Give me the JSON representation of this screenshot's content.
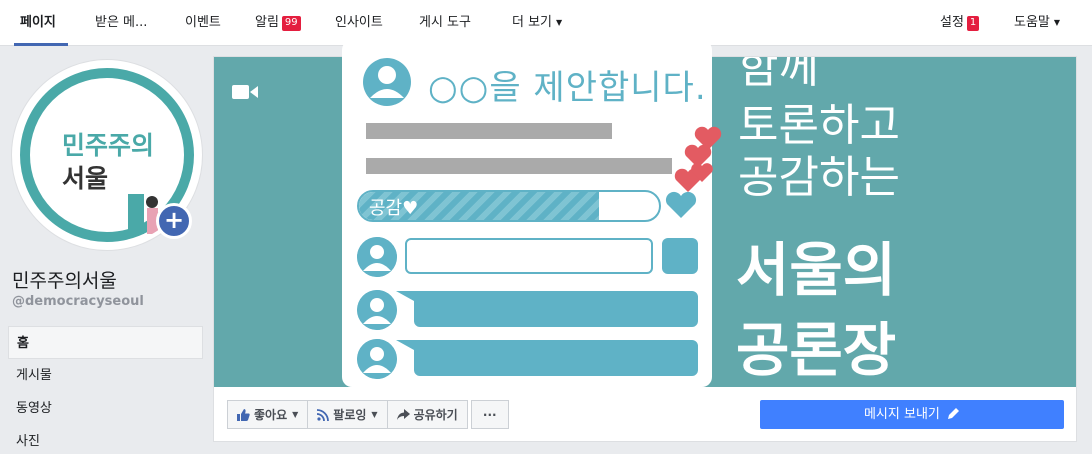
{
  "topnav": {
    "tabs": [
      {
        "label": "페이지"
      },
      {
        "label": "받은 메..."
      },
      {
        "label": "이벤트"
      },
      {
        "label": "알림",
        "badge": "99"
      },
      {
        "label": "인사이트"
      },
      {
        "label": "게시 도구"
      },
      {
        "label": "더 보기"
      }
    ],
    "settings": {
      "label": "설정",
      "badge": "1"
    },
    "help": {
      "label": "도움말"
    }
  },
  "profile": {
    "avatar_line1": "민주주의",
    "avatar_line2": "서울",
    "name": "민주주의서울",
    "handle": "@democracyseoul"
  },
  "leftnav": {
    "items": [
      {
        "label": "홈"
      },
      {
        "label": "게시물"
      },
      {
        "label": "동영상"
      },
      {
        "label": "사진"
      }
    ]
  },
  "cover": {
    "proposal_text": "○○을 제안합니다.",
    "gongam_label": "공감♥",
    "gongam_progress": 0.8,
    "right_line0": "함께",
    "right_line1": "토론하고",
    "right_line2": "공감하는",
    "right_line3": "서울의",
    "right_line4": "공론장"
  },
  "actions": {
    "like": "좋아요",
    "follow": "팔로잉",
    "share": "공유하기",
    "more": "···",
    "message": "메시지 보내기"
  },
  "colors": {
    "brand": "#4267b2",
    "teal": "#62a8ab",
    "message_button": "#4080ff",
    "badge": "#e41e3f"
  }
}
